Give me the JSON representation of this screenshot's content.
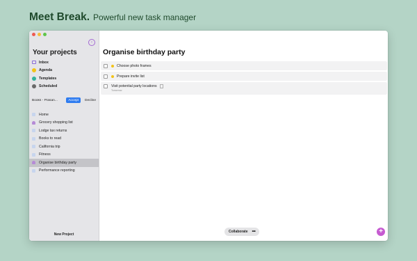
{
  "hero": {
    "brand": "Meet Break.",
    "subtitle": "Powerful new task manager"
  },
  "sidebar": {
    "heading": "Your projects",
    "nav": [
      {
        "label": "Inbox",
        "icon": "inbox-icon"
      },
      {
        "label": "Agenda",
        "icon": "agenda-icon"
      },
      {
        "label": "Templates",
        "icon": "templates-icon"
      },
      {
        "label": "Scheduled",
        "icon": "scheduled-icon"
      }
    ],
    "invite": {
      "name": "Books - Prasan...",
      "accept": "Accept",
      "decline": "Decline"
    },
    "projects": [
      {
        "label": "Home",
        "icon": "document-icon",
        "selected": false
      },
      {
        "label": "Grocery shopping list",
        "icon": "people-icon",
        "selected": false
      },
      {
        "label": "Lodge tax returns",
        "icon": "document-icon",
        "selected": false
      },
      {
        "label": "Books to read",
        "icon": "document-icon",
        "selected": false
      },
      {
        "label": "California trip",
        "icon": "document-icon",
        "selected": false
      },
      {
        "label": "Fitness",
        "icon": "document-icon",
        "selected": false
      },
      {
        "label": "Organise birthday party",
        "icon": "people-icon",
        "selected": true
      },
      {
        "label": "Performance reporting",
        "icon": "document-icon",
        "selected": false
      }
    ],
    "new_project": "New Project"
  },
  "main": {
    "title": "Organise birthday party",
    "tasks": [
      {
        "title": "Choose photo frames",
        "has_dot": true
      },
      {
        "title": "Prepare invite list",
        "has_dot": true
      },
      {
        "title": "Visit potential party locations",
        "has_dot": false,
        "subtext": "Tomorrow"
      }
    ],
    "bottom": {
      "collaborate": "Collaborate",
      "more": "•••",
      "add": "+"
    }
  },
  "colors": {
    "background": "#b4d4c6",
    "brand_text": "#1f4a2c",
    "accent_accept": "#2f7cf0",
    "fab": "#c65bd1",
    "agenda_dot": "#f2c318"
  }
}
